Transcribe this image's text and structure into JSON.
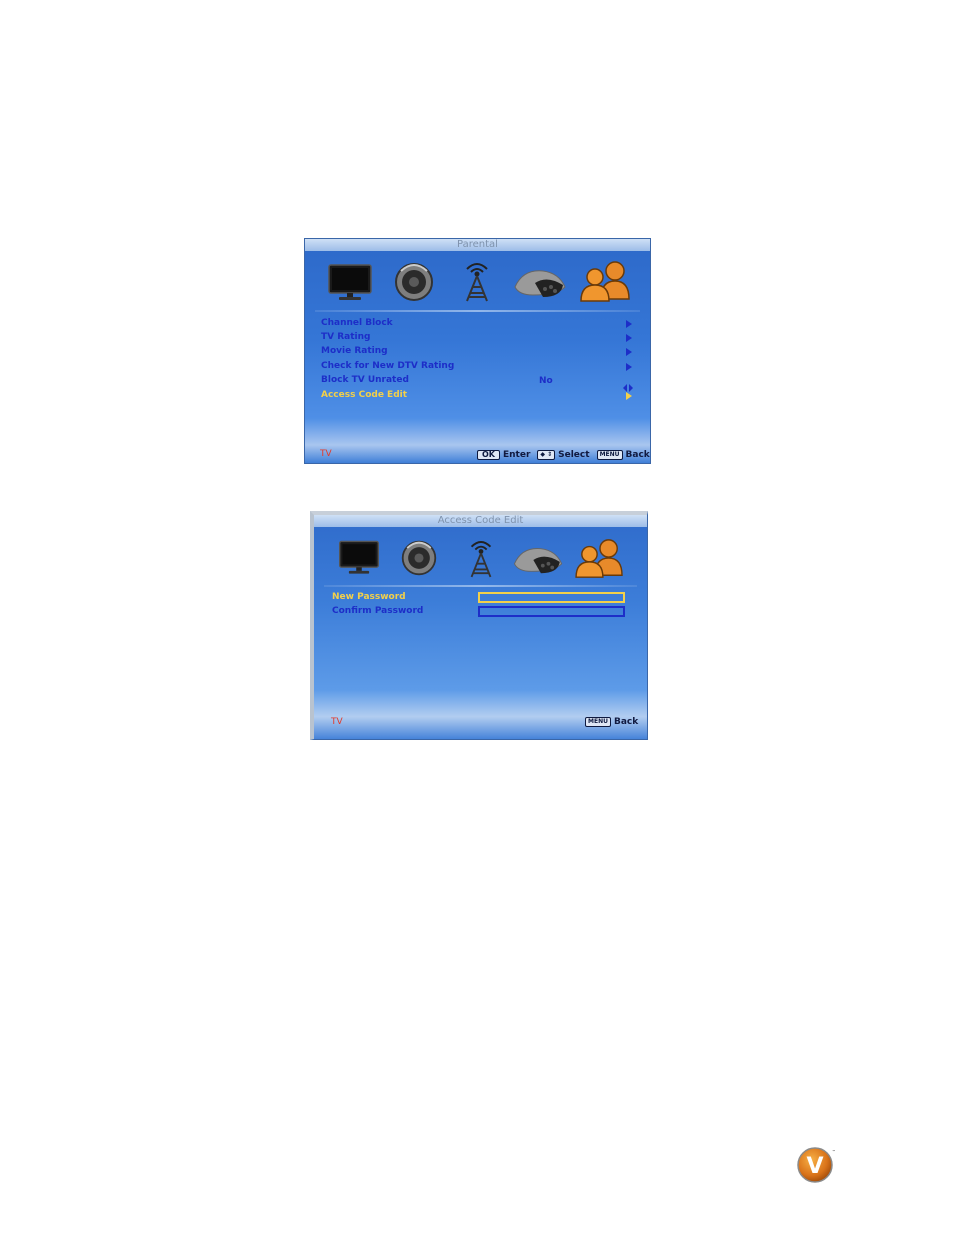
{
  "parental": {
    "title": "Parental",
    "items": [
      {
        "label": "Channel Block",
        "value": "",
        "control": "arrow"
      },
      {
        "label": "TV Rating",
        "value": "",
        "control": "arrow"
      },
      {
        "label": "Movie Rating",
        "value": "",
        "control": "arrow"
      },
      {
        "label": "Check for New DTV Rating",
        "value": "",
        "control": "arrow"
      },
      {
        "label": "Block TV Unrated",
        "value": "No",
        "control": "left-right"
      },
      {
        "label": "Access Code Edit",
        "value": "",
        "control": "arrow",
        "active": true
      }
    ],
    "source": "TV",
    "footer": {
      "ok_key": "OK",
      "enter": "Enter",
      "select": "Select",
      "menu_key": "MENU",
      "back": "Back"
    }
  },
  "access": {
    "title": "Access Code Edit",
    "fields": [
      {
        "label": "New Password",
        "value": "",
        "active": true
      },
      {
        "label": "Confirm Password",
        "value": "",
        "active": false
      }
    ],
    "source": "TV",
    "footer": {
      "menu_key": "MENU",
      "back": "Back"
    }
  },
  "icons": [
    "tv-icon",
    "speaker-icon",
    "antenna-tower-icon",
    "remote-controls-icon",
    "people-icon"
  ],
  "colors": {
    "menu_text": "#1d2ec8",
    "highlight": "#f2d04a",
    "source": "#e23a2a",
    "people_icon": "#e88a2a"
  },
  "logo": {
    "mark": "V",
    "tm": "™"
  }
}
